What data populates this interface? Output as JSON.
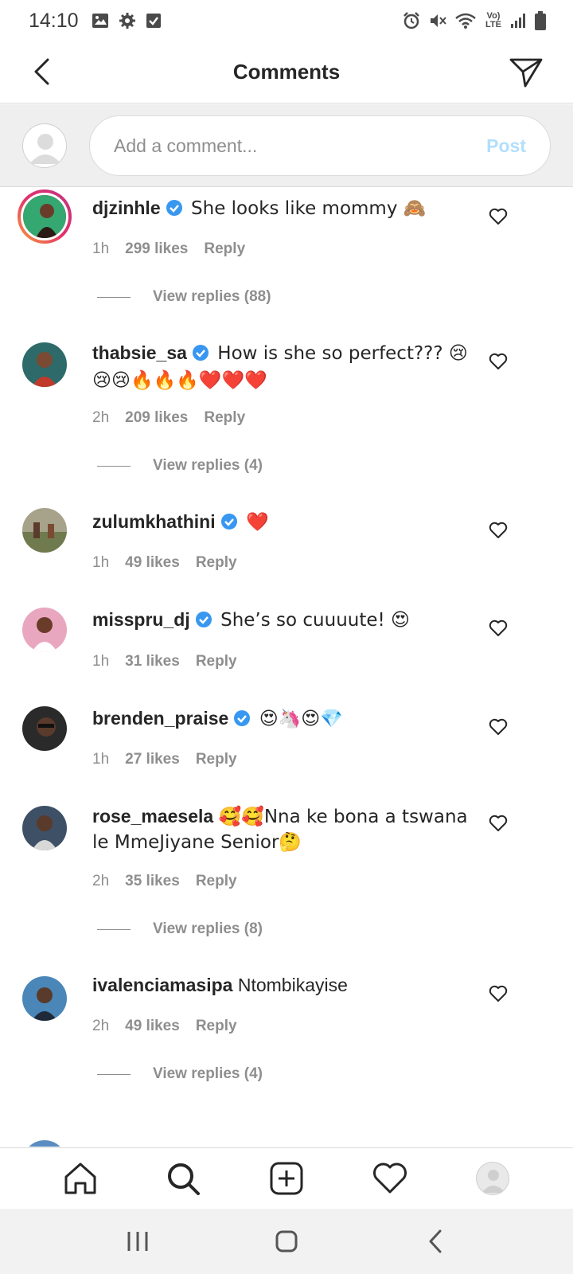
{
  "status_bar": {
    "time": "14:10",
    "left_icons": [
      "image-icon",
      "settings-icon",
      "checkbox-icon"
    ],
    "right_icons": [
      "alarm-icon",
      "mute-icon",
      "wifi-icon",
      "volte-icon",
      "signal-icon",
      "battery-icon"
    ],
    "volte_label": "Vo) LTE"
  },
  "header": {
    "title": "Comments"
  },
  "composer": {
    "placeholder": "Add a comment...",
    "post_label": "Post"
  },
  "colors": {
    "verified": "#3897f0",
    "secondary_text": "#8e8e8e",
    "post_disabled": "#b2dffc",
    "divider": "#dbdbdb"
  },
  "comments": [
    {
      "username": "djzinhle",
      "verified": true,
      "text": "She looks like mommy 🙈",
      "time": "1h",
      "likes": "299 likes",
      "reply": "Reply",
      "view_replies": "View replies (88)"
    },
    {
      "username": "thabsie_sa",
      "verified": true,
      "text": "How is she so perfect??? 😢😢😢🔥🔥🔥❤️❤️❤️",
      "time": "2h",
      "likes": "209 likes",
      "reply": "Reply",
      "view_replies": "View replies (4)"
    },
    {
      "username": "zulumkhathini",
      "verified": true,
      "text": "❤️",
      "time": "1h",
      "likes": "49 likes",
      "reply": "Reply"
    },
    {
      "username": "misspru_dj",
      "verified": true,
      "text": "She’s so cuuuute! 😍",
      "time": "1h",
      "likes": "31 likes",
      "reply": "Reply"
    },
    {
      "username": "brenden_praise",
      "verified": true,
      "text": "😍🦄😍💎",
      "time": "1h",
      "likes": "27 likes",
      "reply": "Reply"
    },
    {
      "username": "rose_maesela",
      "verified": false,
      "text": "🥰🥰Nna ke bona a tswana le MmeJiyane Senior🤔",
      "time": "2h",
      "likes": "35 likes",
      "reply": "Reply",
      "view_replies": "View replies (8)"
    },
    {
      "username": "ivalenciamasipa",
      "verified": false,
      "text": "Ntombikayise",
      "time": "2h",
      "likes": "49 likes",
      "reply": "Reply",
      "view_replies": "View replies (4)"
    }
  ],
  "bottom_nav": [
    "home-icon",
    "search-icon",
    "new-post-icon",
    "activity-heart-icon",
    "profile-avatar"
  ],
  "system_nav": [
    "recents-icon",
    "home-circle-icon",
    "back-chevron-icon"
  ]
}
